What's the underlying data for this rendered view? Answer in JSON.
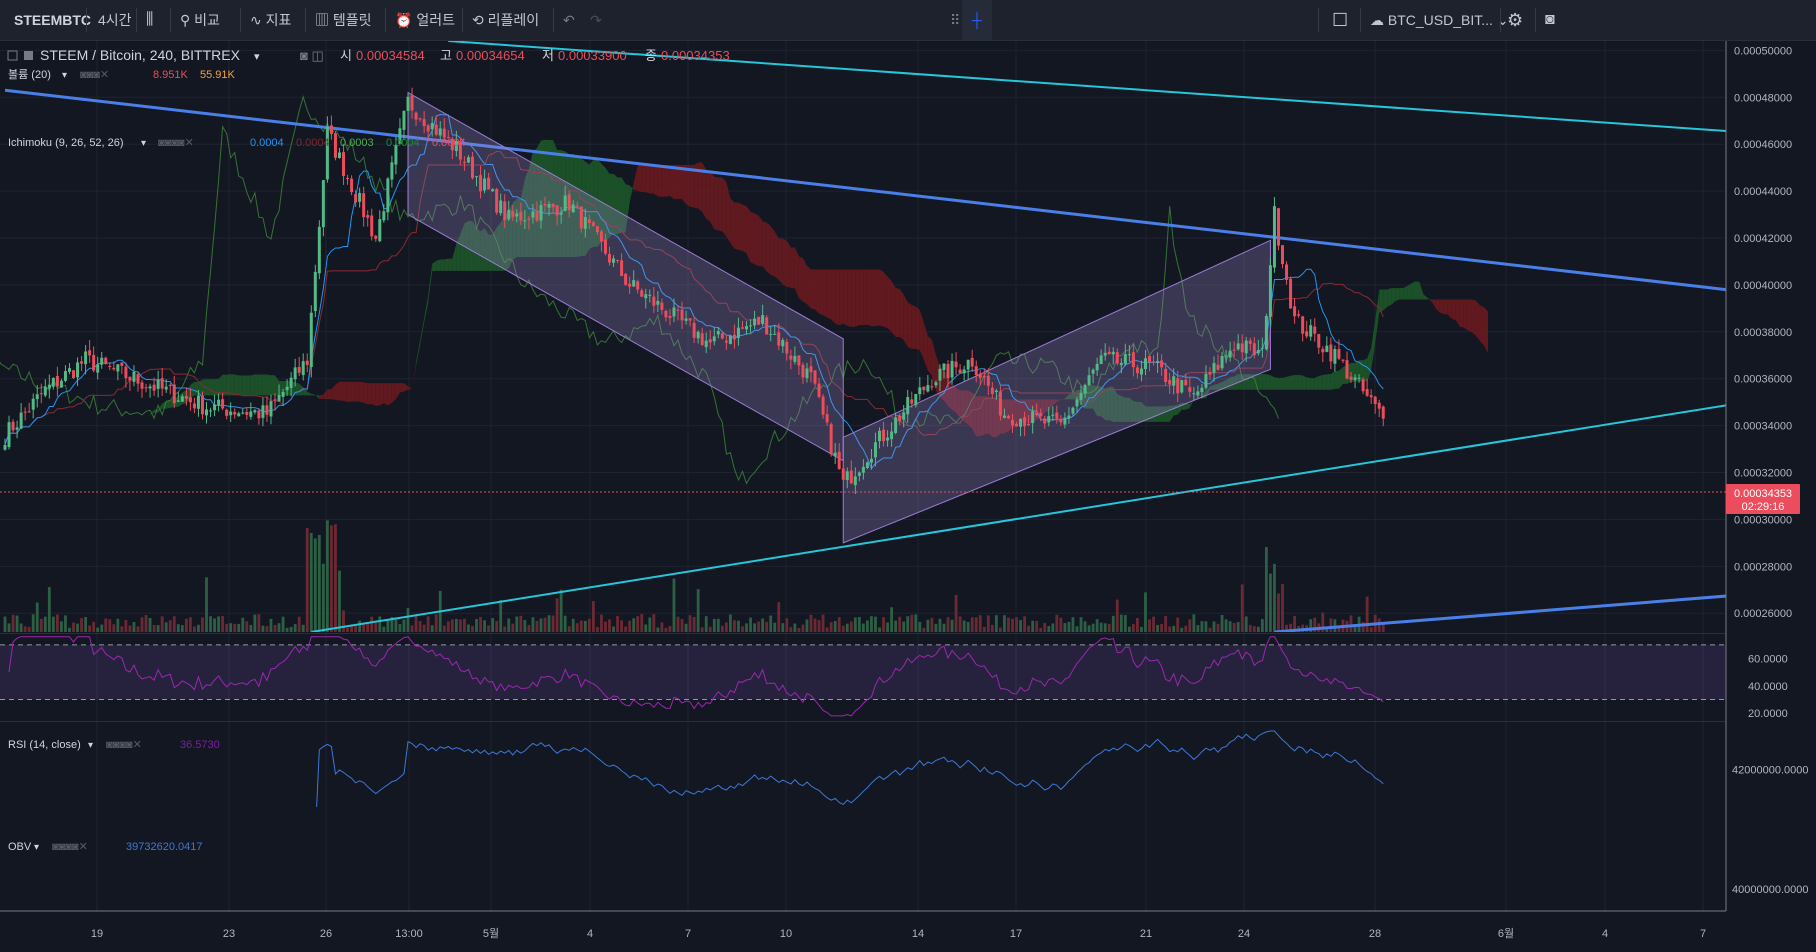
{
  "toolbar": {
    "symbol": "STEEMBTC",
    "interval": "4시간",
    "compare": "비교",
    "indicators": "지표",
    "templates": "템플릿",
    "alert": "얼러트",
    "replay": "리플레이",
    "layout_name": "BTC_USD_BIT..."
  },
  "legend": {
    "title": "STEEM / Bitcoin, 240, BITTREX",
    "open_label": "시",
    "open": "0.00034584",
    "high_label": "고",
    "high": "0.00034654",
    "low_label": "저",
    "low": "0.00033900",
    "close_label": "종",
    "close": "0.00034353",
    "volume_label": "볼륨 (20)",
    "volume_val1": "8.951K",
    "volume_val2": "55.91K",
    "ichimoku_label": "Ichimoku (9, 26, 52, 26)",
    "ichimoku_vals": [
      "0.0004",
      "0.0004",
      "0.0003",
      "0.0004",
      "0.0004"
    ],
    "rsi_label": "RSI (14, close)",
    "rsi_val": "36.5730",
    "obv_label": "OBV",
    "obv_val": "39732620.0417"
  },
  "price_badge": {
    "price": "0.00034353",
    "countdown": "02:29:16"
  },
  "colors": {
    "background": "#131722",
    "up": "#53b987",
    "down": "#eb4d5c",
    "trendline_blue": "#4a7fe8",
    "trendline_cyan": "#27c6d9",
    "cloud_green": "#1e5a2a",
    "cloud_red": "#6e1a1e",
    "rsi": "#9c27b0",
    "obv": "#3c78d8"
  },
  "chart_data": {
    "type": "candlestick",
    "symbol": "STEEM / Bitcoin",
    "price_axis_ticks": [
      "0.00050000",
      "0.00048000",
      "0.00046000",
      "0.00044000",
      "0.00042000",
      "0.00040000",
      "0.00038000",
      "0.00036000",
      "0.00034000",
      "0.00032000",
      "0.00030000",
      "0.00028000",
      "0.00026000"
    ],
    "price_range": [
      0.000252,
      0.000504
    ],
    "rsi_axis_ticks": [
      "60.0000",
      "40.0000",
      "20.0000"
    ],
    "rsi_range": [
      15,
      78
    ],
    "rsi_bands": [
      70,
      30
    ],
    "obv_axis_ticks": [
      "42000000.0000",
      "40000000.0000"
    ],
    "obv_range": [
      39700000,
      42800000
    ],
    "time_axis_labels": [
      "19",
      "23",
      "26",
      "13:00",
      "5월",
      "4",
      "7",
      "10",
      "14",
      "17",
      "21",
      "24",
      "28",
      "6월",
      "4",
      "7"
    ],
    "close_key_points": [
      {
        "bar": 0,
        "close": 0.000336
      },
      {
        "bar": 10,
        "close": 0.000355
      },
      {
        "bar": 20,
        "close": 0.000368
      },
      {
        "bar": 35,
        "close": 0.000358
      },
      {
        "bar": 50,
        "close": 0.000348
      },
      {
        "bar": 65,
        "close": 0.000345
      },
      {
        "bar": 75,
        "close": 0.000368
      },
      {
        "bar": 80,
        "close": 0.000465
      },
      {
        "bar": 92,
        "close": 0.00042
      },
      {
        "bar": 100,
        "close": 0.000478
      },
      {
        "bar": 112,
        "close": 0.000458
      },
      {
        "bar": 125,
        "close": 0.000428
      },
      {
        "bar": 140,
        "close": 0.000435
      },
      {
        "bar": 155,
        "close": 0.0004
      },
      {
        "bar": 175,
        "close": 0.000375
      },
      {
        "bar": 188,
        "close": 0.000385
      },
      {
        "bar": 200,
        "close": 0.00036
      },
      {
        "bar": 208,
        "close": 0.000315
      },
      {
        "bar": 215,
        "close": 0.00033
      },
      {
        "bar": 230,
        "close": 0.00036
      },
      {
        "bar": 240,
        "close": 0.000368
      },
      {
        "bar": 248,
        "close": 0.000345
      },
      {
        "bar": 262,
        "close": 0.00034
      },
      {
        "bar": 272,
        "close": 0.000368
      },
      {
        "bar": 285,
        "close": 0.000365
      },
      {
        "bar": 295,
        "close": 0.000352
      },
      {
        "bar": 305,
        "close": 0.000375
      },
      {
        "bar": 312,
        "close": 0.00037
      },
      {
        "bar": 315,
        "close": 0.00043
      },
      {
        "bar": 320,
        "close": 0.000385
      },
      {
        "bar": 330,
        "close": 0.00037
      },
      {
        "bar": 342,
        "close": 0.000343
      }
    ],
    "drawings": [
      {
        "type": "trend_line",
        "color": "blue",
        "from": {
          "bar": 0,
          "price": 0.000483
        },
        "to": {
          "bar": 432,
          "price": 0.000397
        }
      },
      {
        "type": "trend_line",
        "color": "cyan",
        "from": {
          "bar": 110,
          "price": 0.000504
        },
        "to": {
          "bar": 432,
          "price": 0.000465
        }
      },
      {
        "type": "trend_line",
        "color": "cyan",
        "from": {
          "bar": 76,
          "price": 0.000252
        },
        "to": {
          "bar": 432,
          "price": 0.00035
        }
      },
      {
        "type": "trend_line",
        "color": "blue",
        "from": {
          "bar": 315,
          "price": 0.000252
        },
        "to": {
          "bar": 432,
          "price": 0.000268
        }
      },
      {
        "type": "channel",
        "color": "purple",
        "points": [
          {
            "bar": 100,
            "price": 0.000482
          },
          {
            "bar": 208,
            "price": 0.000377
          },
          {
            "bar": 208,
            "price": 0.000325
          },
          {
            "bar": 100,
            "price": 0.00043
          }
        ]
      },
      {
        "type": "channel",
        "color": "purple",
        "points": [
          {
            "bar": 208,
            "price": 0.000335
          },
          {
            "bar": 314,
            "price": 0.000419
          },
          {
            "bar": 314,
            "price": 0.000364
          },
          {
            "bar": 208,
            "price": 0.00029
          }
        ]
      }
    ]
  }
}
